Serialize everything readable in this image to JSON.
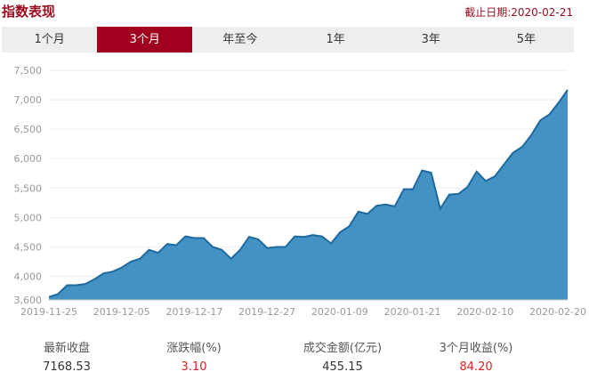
{
  "header": {
    "title": "指数表现",
    "as_of": "截止日期:2020-02-21"
  },
  "tabs": [
    {
      "label": "1个月",
      "active": false
    },
    {
      "label": "3个月",
      "active": true
    },
    {
      "label": "年至今",
      "active": false
    },
    {
      "label": "1年",
      "active": false
    },
    {
      "label": "3年",
      "active": false
    },
    {
      "label": "5年",
      "active": false
    }
  ],
  "stats": [
    {
      "label": "最新收盘",
      "value": "7168.53",
      "color": "#333333"
    },
    {
      "label": "涨跌幅(%)",
      "value": "3.10",
      "color": "#e02020"
    },
    {
      "label": "成交金额(亿元)",
      "value": "455.15",
      "color": "#333333"
    },
    {
      "label": "3个月收益(%)",
      "value": "84.20",
      "color": "#e02020"
    }
  ],
  "colors": {
    "accent": "#a0001e",
    "fill": "#3a8cc0",
    "line": "#1e6aa0"
  },
  "chart_data": {
    "type": "area",
    "title": "",
    "xlabel": "",
    "ylabel": "",
    "ylim": [
      3600,
      7500
    ],
    "yticks": [
      "3,600",
      "4,000",
      "4,500",
      "5,000",
      "5,500",
      "6,000",
      "6,500",
      "7,000",
      "7,500"
    ],
    "ytick_values": [
      3600,
      4000,
      4500,
      5000,
      5500,
      6000,
      6500,
      7000,
      7500
    ],
    "xticks": [
      "2019-11-25",
      "2019-12-05",
      "2019-12-17",
      "2019-12-27",
      "2020-01-09",
      "2020-01-21",
      "2020-02-10",
      "2020-02-20"
    ],
    "grid": true,
    "series": [
      {
        "values": [
          3650,
          3700,
          3850,
          3850,
          3870,
          3950,
          4050,
          4080,
          4150,
          4250,
          4300,
          4450,
          4400,
          4550,
          4530,
          4680,
          4650,
          4650,
          4500,
          4450,
          4300,
          4450,
          4670,
          4630,
          4480,
          4500,
          4500,
          4680,
          4670,
          4700,
          4680,
          4560,
          4750,
          4850,
          5100,
          5060,
          5200,
          5220,
          5190,
          5480,
          5480,
          5800,
          5760,
          5150,
          5390,
          5400,
          5520,
          5780,
          5620,
          5700,
          5900,
          6100,
          6200,
          6400,
          6650,
          6750,
          6950,
          7168.53
        ]
      }
    ]
  }
}
